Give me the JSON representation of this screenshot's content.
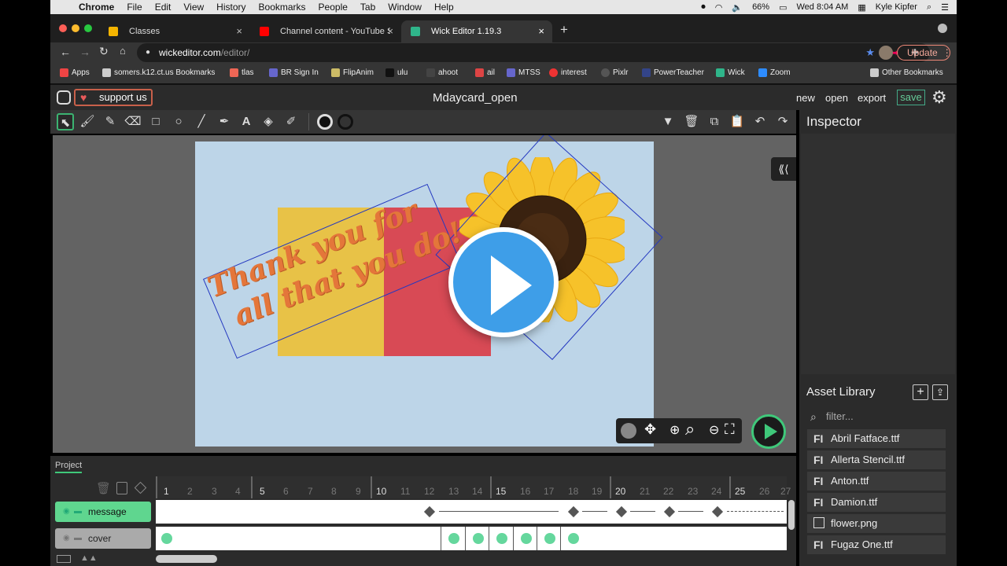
{
  "menubar": {
    "app": "Chrome",
    "items": [
      "File",
      "Edit",
      "View",
      "History",
      "Bookmarks",
      "People",
      "Tab",
      "Window",
      "Help"
    ],
    "battery": "66%",
    "clock": "Wed 8:04 AM",
    "user": "Kyle Kipfer"
  },
  "tabs": [
    {
      "label": "Classes",
      "active": false
    },
    {
      "label": "Channel content - YouTube St…",
      "active": false
    },
    {
      "label": "Wick Editor 1.19.3",
      "active": true
    }
  ],
  "address": {
    "url_host": "wickeditor.com",
    "url_path": "/editor/",
    "update_label": "Update"
  },
  "bookmarks": [
    {
      "label": "Apps"
    },
    {
      "label": "somers.k12.ct.us Bookmarks"
    },
    {
      "label": "tlas"
    },
    {
      "label": "BR Sign In"
    },
    {
      "label": "FlipAnim"
    },
    {
      "label": "ulu"
    },
    {
      "label": "ahoot"
    },
    {
      "label": "ail"
    },
    {
      "label": "MTSS"
    },
    {
      "label": "interest"
    },
    {
      "label": "Pixlr"
    },
    {
      "label": "PowerTeacher"
    },
    {
      "label": "Wick"
    },
    {
      "label": "Zoom"
    }
  ],
  "other_bookmarks": "Other Bookmarks",
  "wick": {
    "support_label": "support us",
    "project_title": "Mdaycard_open",
    "menu": {
      "new": "new",
      "open": "open",
      "export": "export",
      "save": "save"
    },
    "inspector_title": "Inspector",
    "asset_library_title": "Asset Library",
    "filter_placeholder": "filter...",
    "assets": [
      {
        "name": "Abril Fatface.ttf",
        "icon": "font-icon"
      },
      {
        "name": "Allerta Stencil.ttf",
        "icon": "font-icon"
      },
      {
        "name": "Anton.ttf",
        "icon": "font-icon"
      },
      {
        "name": "Damion.ttf",
        "icon": "font-icon"
      },
      {
        "name": "flower.png",
        "icon": "image-icon"
      },
      {
        "name": "Fugaz One.ttf",
        "icon": "font-icon"
      }
    ]
  },
  "canvas": {
    "text_line1": "Thank you for",
    "text_line2": "all that you do!",
    "text_color": "#e4763a",
    "yellow": "#e8c247",
    "red": "#d84a55",
    "stage_bg": "#bdd5e8"
  },
  "timeline": {
    "tab_label": "Project",
    "frame_numbers": [
      "1",
      "2",
      "3",
      "4",
      "5",
      "6",
      "7",
      "8",
      "9",
      "10",
      "11",
      "12",
      "13",
      "14",
      "15",
      "16",
      "17",
      "18",
      "19",
      "20",
      "21",
      "22",
      "23",
      "24",
      "25",
      "26",
      "27"
    ],
    "layers": [
      {
        "name": "message",
        "active": true
      },
      {
        "name": "cover",
        "active": false
      }
    ]
  }
}
